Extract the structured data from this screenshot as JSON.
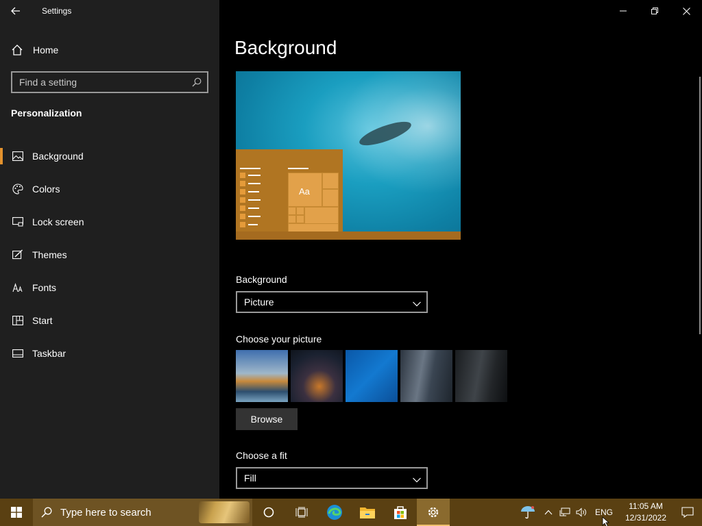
{
  "window": {
    "title": "Settings"
  },
  "sidebar": {
    "home_label": "Home",
    "search_placeholder": "Find a setting",
    "section_title": "Personalization",
    "items": [
      {
        "label": "Background",
        "icon": "image-icon",
        "active": true
      },
      {
        "label": "Colors",
        "icon": "palette-icon"
      },
      {
        "label": "Lock screen",
        "icon": "lock-screen-icon"
      },
      {
        "label": "Themes",
        "icon": "themes-icon"
      },
      {
        "label": "Fonts",
        "icon": "fonts-icon"
      },
      {
        "label": "Start",
        "icon": "start-icon"
      },
      {
        "label": "Taskbar",
        "icon": "taskbar-icon"
      }
    ]
  },
  "main": {
    "title": "Background",
    "preview_sample_text": "Aa",
    "background_label": "Background",
    "background_value": "Picture",
    "choose_picture_label": "Choose your picture",
    "browse_label": "Browse",
    "choose_fit_label": "Choose a fit",
    "fit_value": "Fill"
  },
  "taskbar": {
    "search_placeholder": "Type here to search",
    "apps": [
      "cortana-icon",
      "task-view-icon",
      "edge-icon",
      "file-explorer-icon",
      "store-icon",
      "settings-icon"
    ],
    "language": "ENG",
    "time": "11:05 AM",
    "date": "12/31/2022"
  },
  "colors": {
    "accent": "#e3922d",
    "taskbar": "#5a4012"
  }
}
